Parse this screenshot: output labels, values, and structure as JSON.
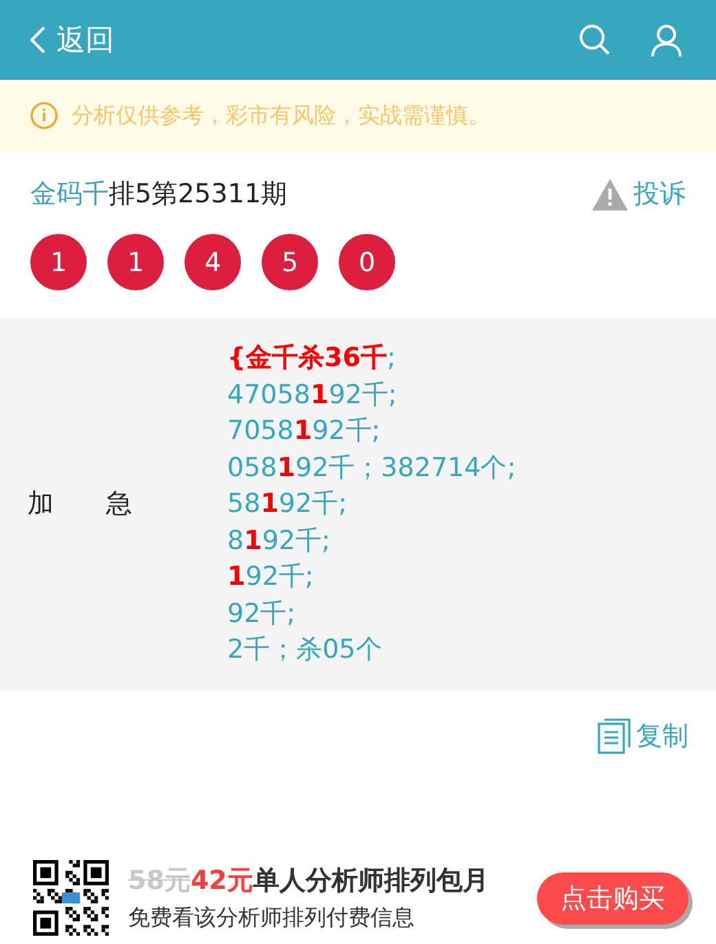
{
  "header": {
    "back": "返回"
  },
  "notice": "分析仅供参考，彩市有风险，实战需谨慎。",
  "title": {
    "author": "金码千",
    "issue": "排5第25311期"
  },
  "complain": "投诉",
  "balls": [
    "1",
    "1",
    "4",
    "5",
    "0"
  ],
  "plan": {
    "label": "加　　急",
    "lines": [
      "**{金千杀36千**;",
      "47058**1**92千;",
      "7058**1**92千;",
      "058**1**92千；382714个;",
      "58**1**92千;",
      "8**1**92千;",
      "**1**92千;",
      "92千;",
      "2千；杀05个"
    ]
  },
  "copy": "复制",
  "offer": {
    "old_price": "58元",
    "price": "42元",
    "name": "单人分析师排列包月",
    "desc": "免费看该分析师排列付费信息",
    "button": "点击购买"
  }
}
